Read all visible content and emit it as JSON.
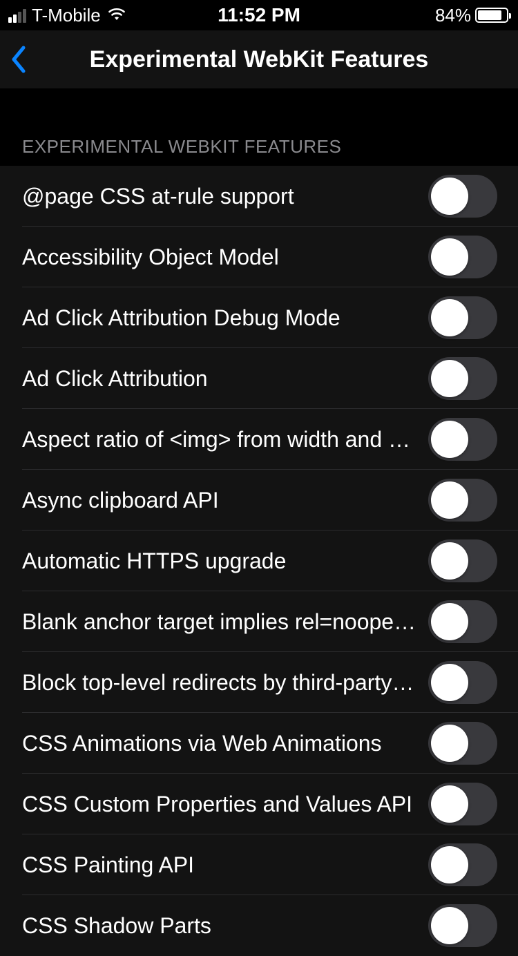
{
  "status_bar": {
    "carrier": "T-Mobile",
    "time": "11:52 PM",
    "battery_pct": "84%",
    "battery_fill_pct": 84,
    "signal_strength": 2
  },
  "nav": {
    "title": "Experimental WebKit Features"
  },
  "section": {
    "header": "EXPERIMENTAL WEBKIT FEATURES",
    "items": [
      {
        "label": "@page CSS at-rule support",
        "on": false
      },
      {
        "label": "Accessibility Object Model",
        "on": false
      },
      {
        "label": "Ad Click Attribution Debug Mode",
        "on": false
      },
      {
        "label": "Ad Click Attribution",
        "on": false
      },
      {
        "label": "Aspect ratio of <img> from width and height",
        "on": false
      },
      {
        "label": "Async clipboard API",
        "on": false
      },
      {
        "label": "Automatic HTTPS upgrade",
        "on": false
      },
      {
        "label": "Blank anchor target implies rel=noopener",
        "on": false
      },
      {
        "label": "Block top-level redirects by third-party iframes",
        "on": false
      },
      {
        "label": "CSS Animations via Web Animations",
        "on": false
      },
      {
        "label": "CSS Custom Properties and Values API",
        "on": false
      },
      {
        "label": "CSS Painting API",
        "on": false
      },
      {
        "label": "CSS Shadow Parts",
        "on": false
      }
    ]
  }
}
